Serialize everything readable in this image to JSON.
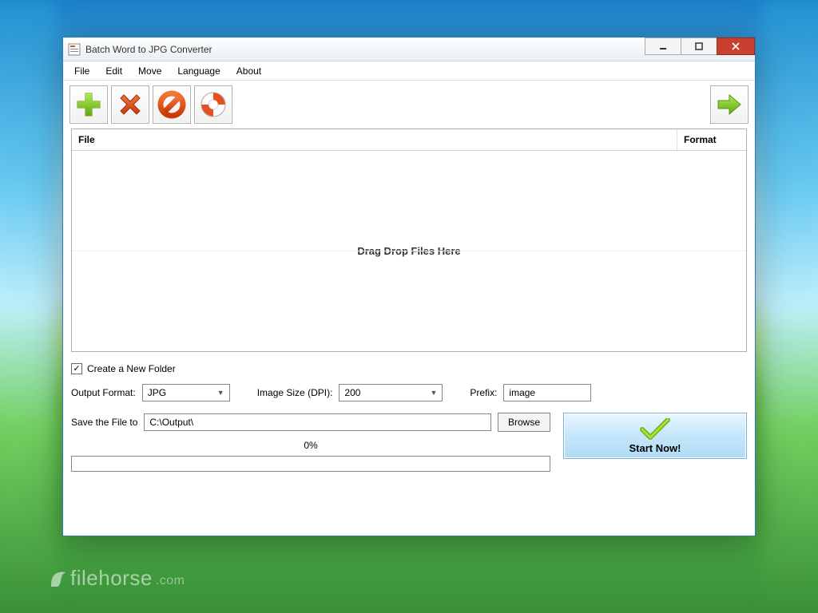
{
  "window": {
    "title": "Batch Word to JPG Converter"
  },
  "menu": {
    "items": [
      "File",
      "Edit",
      "Move",
      "Language",
      "About"
    ]
  },
  "toolbar": {
    "add_icon": "plus-icon",
    "delete_icon": "x-icon",
    "clear_icon": "no-icon",
    "help_icon": "lifebuoy-icon",
    "next_icon": "arrow-right-icon"
  },
  "filelist": {
    "col_file": "File",
    "col_format": "Format",
    "placeholder": "Drag  Drop Files Here"
  },
  "options": {
    "create_folder_label": "Create a New Folder",
    "create_folder_checked": true,
    "output_format_label": "Output Format:",
    "output_format_value": "JPG",
    "image_size_label": "Image Size (DPI):",
    "image_size_value": "200",
    "prefix_label": "Prefix:",
    "prefix_value": "image",
    "save_to_label": "Save the File to",
    "save_to_value": "C:\\Output\\",
    "browse_label": "Browse"
  },
  "progress": {
    "percent_label": "0%"
  },
  "start": {
    "label": "Start Now!"
  },
  "watermark": {
    "text": "filehorse",
    "suffix": ".com"
  }
}
